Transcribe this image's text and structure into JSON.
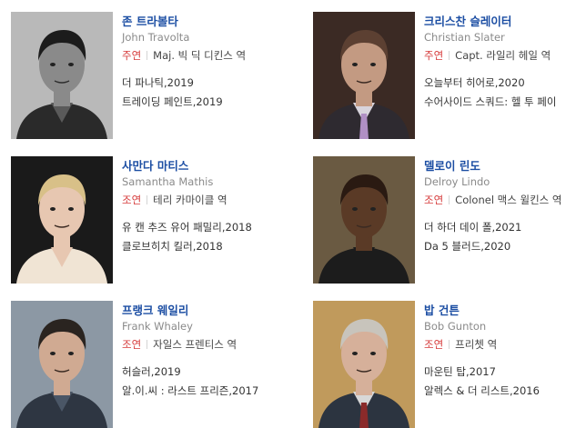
{
  "cast": [
    {
      "name": "존 트라볼타",
      "english_name": "John Travolta",
      "role_type": "주연",
      "role_name": "Maj. 빅 딕 디킨스 역",
      "works": [
        "더 파나틱,2019",
        "트레이딩 페인트,2019"
      ],
      "photo": {
        "bg": "#b9b9b9",
        "skin": "#8a8a8a",
        "hair": "#1c1c1c",
        "clothes": "#2a2a2a",
        "shirt": "#5a5a5a",
        "grayscale": true
      }
    },
    {
      "name": "크리스찬 슬레이터",
      "english_name": "Christian Slater",
      "role_type": "주연",
      "role_name": "Capt. 라일리 헤일 역",
      "works": [
        "오늘부터 히어로,2020",
        "수어사이드 스쿼드: 헬 투 페이"
      ],
      "photo": {
        "bg": "#3b2a24",
        "skin": "#c39a82",
        "hair": "#5c4032",
        "clothes": "#2e2a30",
        "shirt": "#d8d4dc",
        "tie": "#b08fc4"
      }
    },
    {
      "name": "사만다 마티스",
      "english_name": "Samantha Mathis",
      "role_type": "조연",
      "role_name": "테리 카마이클 역",
      "works": [
        "유 캔 추즈 유어 패밀리,2018",
        "클로브히치 킬러,2018"
      ],
      "photo": {
        "bg": "#1a1a1a",
        "skin": "#e7c7b1",
        "hair": "#d8c088",
        "clothes": "#f0e4d4",
        "shirt": "#e7c7b1"
      }
    },
    {
      "name": "델로이 린도",
      "english_name": "Delroy Lindo",
      "role_type": "조연",
      "role_name": "Colonel 맥스 윌킨스 역",
      "works": [
        "더 하더 데이 폴,2021",
        "Da 5 블러드,2020"
      ],
      "photo": {
        "bg": "#6a5a42",
        "skin": "#5a3a26",
        "hair": "#2a1a12",
        "clothes": "#1c1c1c",
        "shirt": "#1c1c1c"
      }
    },
    {
      "name": "프랭크 웨일리",
      "english_name": "Frank Whaley",
      "role_type": "조연",
      "role_name": "자일스 프렌티스 역",
      "works": [
        "허슬러,2019",
        "알.이.씨 : 라스트 프리즌,2017"
      ],
      "photo": {
        "bg": "#8c98a4",
        "skin": "#d0aa92",
        "hair": "#2a2420",
        "clothes": "#2e3642",
        "shirt": "#4a5666"
      }
    },
    {
      "name": "밥 건튼",
      "english_name": "Bob Gunton",
      "role_type": "조연",
      "role_name": "프리쳇 역",
      "works": [
        "마운틴 탑,2017",
        "알렉스 & 더 리스트,2016"
      ],
      "photo": {
        "bg": "#c09a5c",
        "skin": "#d6b09a",
        "hair": "#c8c4bc",
        "clothes": "#2c3440",
        "shirt": "#d8d8d8",
        "tie": "#8a2a2a"
      }
    }
  ]
}
